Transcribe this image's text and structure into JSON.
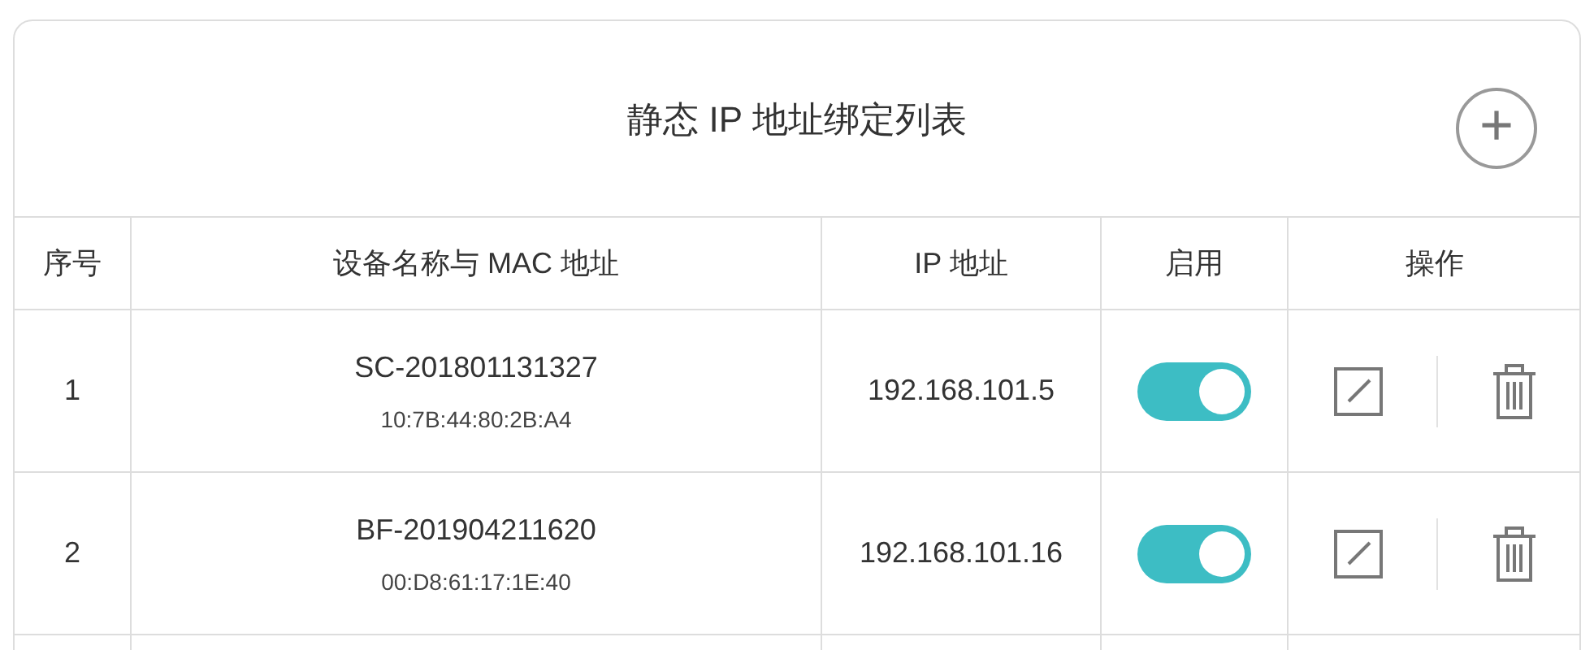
{
  "title": "静态 IP 地址绑定列表",
  "add_button": "+",
  "columns": [
    "序号",
    "设备名称与 MAC 地址",
    "IP 地址",
    "启用",
    "操作"
  ],
  "rows": [
    {
      "index": "1",
      "device": "SC-201801131327",
      "mac": "10:7B:44:80:2B:A4",
      "ip": "192.168.101.5",
      "on": true
    },
    {
      "index": "2",
      "device": "BF-201904211620",
      "mac": "00:D8:61:17:1E:40",
      "ip": "192.168.101.16",
      "on": true
    }
  ]
}
